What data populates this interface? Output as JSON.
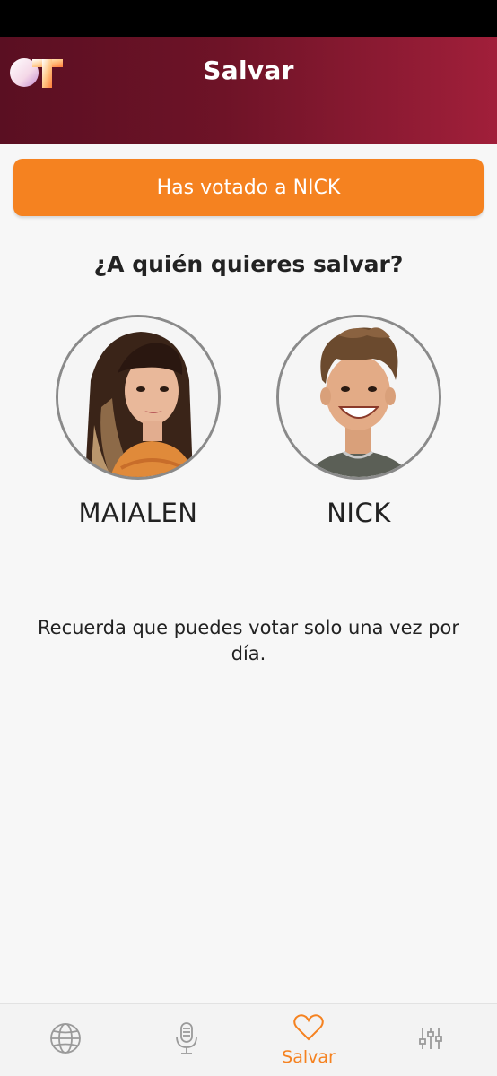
{
  "header": {
    "title": "Salvar",
    "logo": "ot-logo"
  },
  "banner": {
    "text": "Has votado a NICK",
    "color": "#f58220"
  },
  "question": "¿A quién quieres salvar?",
  "candidates": [
    {
      "name": "MAIALEN",
      "photo": "maialen-photo"
    },
    {
      "name": "NICK",
      "photo": "nick-photo"
    }
  ],
  "reminder": "Recuerda que puedes votar solo una vez por día.",
  "nav": {
    "items": [
      {
        "icon": "globe-icon",
        "label": ""
      },
      {
        "icon": "microphone-icon",
        "label": ""
      },
      {
        "icon": "heart-icon",
        "label": "Salvar",
        "active": true
      },
      {
        "icon": "sliders-icon",
        "label": ""
      }
    ]
  },
  "colors": {
    "accent": "#f58220",
    "header_dark": "#5a0f22",
    "header_light": "#a11f3a"
  }
}
